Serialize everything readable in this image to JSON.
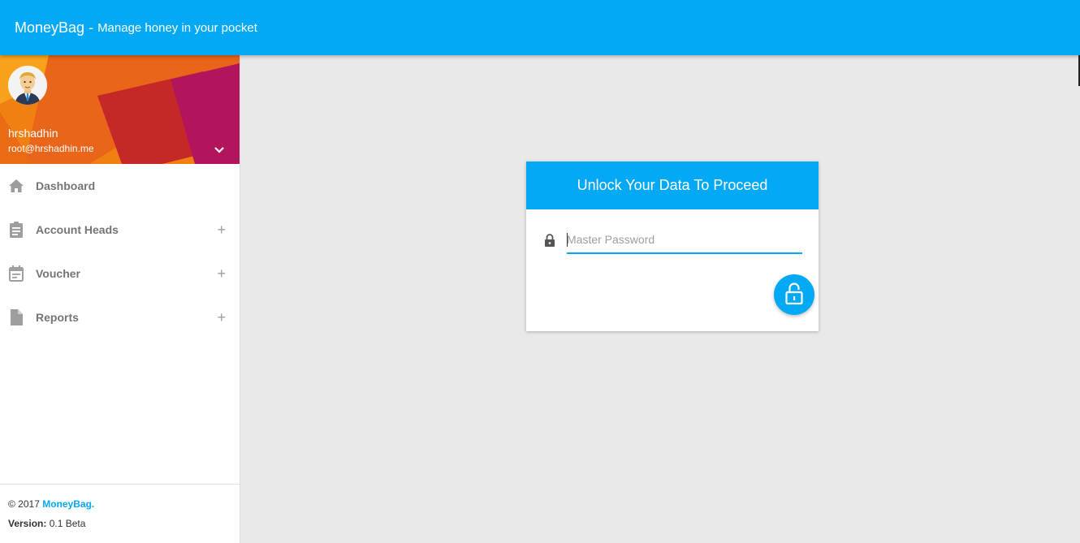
{
  "app": {
    "title": "MoneyBag",
    "separator": "-",
    "tagline": "Manage honey in your pocket"
  },
  "user": {
    "name": "hrshadhin",
    "email": "root@hrshadhin.me"
  },
  "sidebar": {
    "items": [
      {
        "label": "Dashboard",
        "icon": "home-icon",
        "expandable": false
      },
      {
        "label": "Account Heads",
        "icon": "clipboard-icon",
        "expandable": true
      },
      {
        "label": "Voucher",
        "icon": "calendar-icon",
        "expandable": true
      },
      {
        "label": "Reports",
        "icon": "file-icon",
        "expandable": true
      }
    ],
    "expand_symbol": "+"
  },
  "footer": {
    "copyright": "© 2017",
    "brand_link": "MoneyBag",
    "brand_suffix": ".",
    "version_label": "Version:",
    "version_value": "0.1 Beta"
  },
  "unlock_card": {
    "title": "Unlock Your Data To Proceed",
    "password_placeholder": "Master Password",
    "password_value": ""
  },
  "colors": {
    "primary": "#03a9f4",
    "background": "#e9e9e9",
    "sidebar_text": "#757575"
  }
}
